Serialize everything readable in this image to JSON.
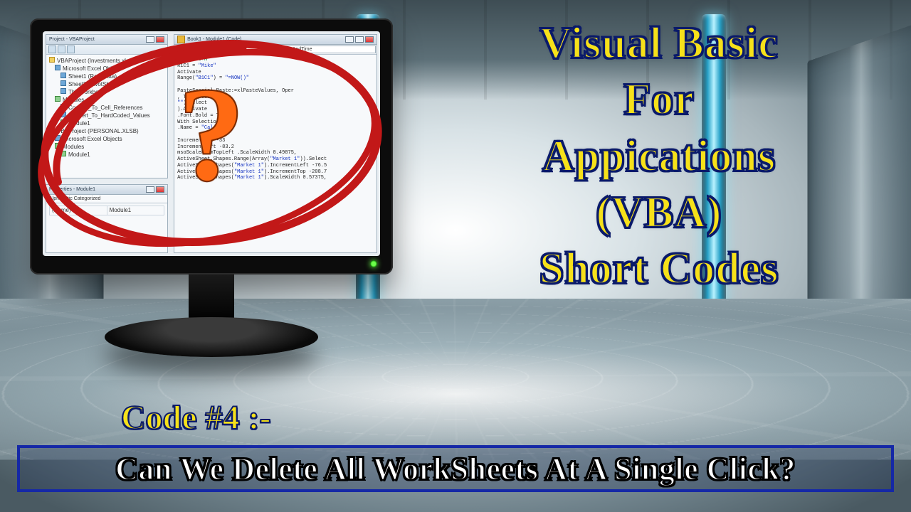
{
  "title": {
    "line1": "Visual Basic",
    "line2": "For",
    "line3": "Appications",
    "line4": "(VBA)",
    "line5": "Short Codes"
  },
  "code_label": "Code #4 :-",
  "question_bar": "Can We Delete All WorkSheets At A Single Click?",
  "question_mark": "?",
  "vbe": {
    "project_title": "Project - VBAProject",
    "props_title": "Properties - Module1",
    "code_title": "Book1 - Module1 (Code)",
    "dropdown_left": "(General)",
    "dropdown_right": "NameAndTime",
    "props_tabs": "Alphabetic  Categorized",
    "props_row_key": "(Name)",
    "props_row_val": "Module1",
    "tree": [
      "VBAProject (Investments.xlsm)",
      "  Microsoft Excel Objects",
      "    Sheet1 (Raw Data)",
      "    Sheet2 (PivotSheet)",
      "    ThisWorkbook",
      "  Modules",
      "    Convert_To_Cell_References",
      "    Convert_To_HardCoded_Values",
      "    Module1",
      "VBAProject (PERSONAL.XLSB)",
      "  Microsoft Excel Objects",
      "  Modules",
      "    Module1"
    ],
    "code_lines": [
      "' +Shift+N",
      "R1C1 = \"Mike\"",
      "Activate",
      "Range(\"B1C1\") = \"=NOW()\"",
      "",
      "PasteSpecial Paste:=xlPasteValues, Oper",
      "  , Transpose:=False",
      "\"\").Select",
      ").Activate",
      ".Font.Bold = True",
      "With Selection.Font",
      "  .Name = \"Calibri\"",
      "",
      "                       IncrementTop  -33",
      "                       IncrementLeft -83.2",
      "msoScaleFromTopLeft    .ScaleWidth 0.49875,",
      "ActiveSheet.Shapes.Range(Array(\"Market 1\")).Select",
      "ActiveSheet.Shapes(\"Market 1\").IncrementLeft -76.5",
      "ActiveSheet.Shapes(\"Market 1\").IncrementTop  -208.7",
      "ActiveSheet.Shapes(\"Market 1\").ScaleWidth 0.57375,"
    ]
  }
}
